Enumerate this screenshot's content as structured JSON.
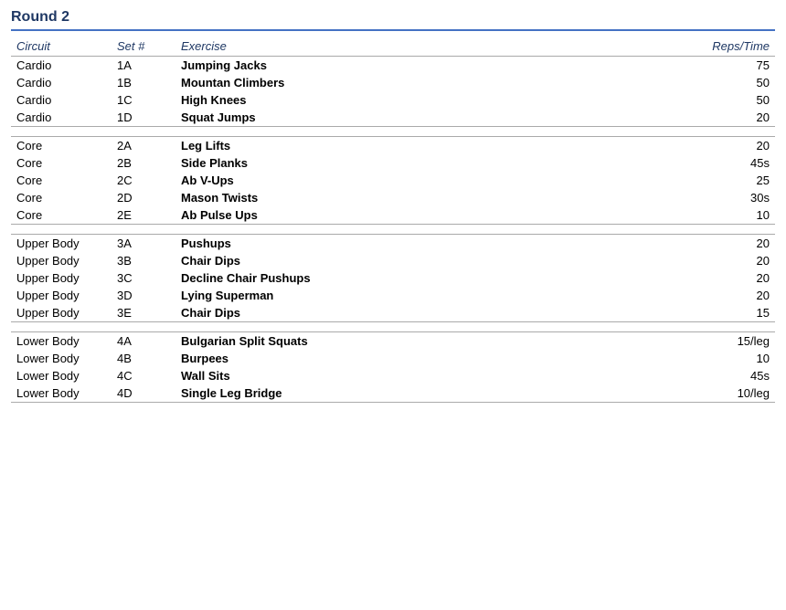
{
  "title": "Round 2",
  "headers": {
    "circuit": "Circuit",
    "set": "Set #",
    "exercise": "Exercise",
    "reps": "Reps/Time"
  },
  "groups": [
    {
      "rows": [
        {
          "circuit": "Cardio",
          "set": "1A",
          "exercise": "Jumping Jacks",
          "reps": "75"
        },
        {
          "circuit": "Cardio",
          "set": "1B",
          "exercise": "Mountan Climbers",
          "reps": "50"
        },
        {
          "circuit": "Cardio",
          "set": "1C",
          "exercise": "High Knees",
          "reps": "50"
        },
        {
          "circuit": "Cardio",
          "set": "1D",
          "exercise": "Squat Jumps",
          "reps": "20"
        }
      ]
    },
    {
      "rows": [
        {
          "circuit": "Core",
          "set": "2A",
          "exercise": "Leg Lifts",
          "reps": "20"
        },
        {
          "circuit": "Core",
          "set": "2B",
          "exercise": "Side Planks",
          "reps": "45s"
        },
        {
          "circuit": "Core",
          "set": "2C",
          "exercise": "Ab V-Ups",
          "reps": "25"
        },
        {
          "circuit": "Core",
          "set": "2D",
          "exercise": "Mason Twists",
          "reps": "30s"
        },
        {
          "circuit": "Core",
          "set": "2E",
          "exercise": "Ab Pulse Ups",
          "reps": "10"
        }
      ]
    },
    {
      "rows": [
        {
          "circuit": "Upper Body",
          "set": "3A",
          "exercise": "Pushups",
          "reps": "20"
        },
        {
          "circuit": "Upper Body",
          "set": "3B",
          "exercise": "Chair Dips",
          "reps": "20"
        },
        {
          "circuit": "Upper Body",
          "set": "3C",
          "exercise": "Decline Chair Pushups",
          "reps": "20"
        },
        {
          "circuit": "Upper Body",
          "set": "3D",
          "exercise": "Lying Superman",
          "reps": "20"
        },
        {
          "circuit": "Upper Body",
          "set": "3E",
          "exercise": "Chair Dips",
          "reps": "15"
        }
      ]
    },
    {
      "rows": [
        {
          "circuit": "Lower Body",
          "set": "4A",
          "exercise": "Bulgarian Split Squats",
          "reps": "15/leg"
        },
        {
          "circuit": "Lower Body",
          "set": "4B",
          "exercise": "Burpees",
          "reps": "10"
        },
        {
          "circuit": "Lower Body",
          "set": "4C",
          "exercise": "Wall Sits",
          "reps": "45s"
        },
        {
          "circuit": "Lower Body",
          "set": "4D",
          "exercise": "Single Leg Bridge",
          "reps": "10/leg"
        }
      ]
    }
  ]
}
